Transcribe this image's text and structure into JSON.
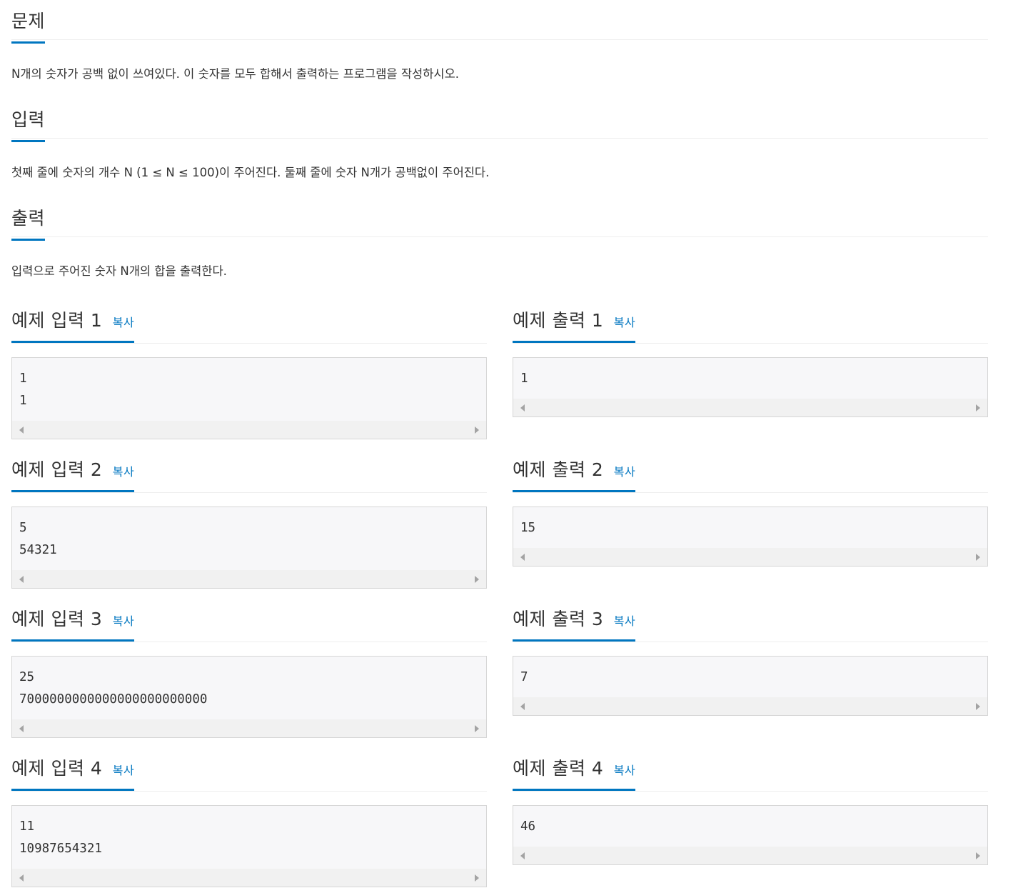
{
  "sections": [
    {
      "title": "문제",
      "text": "N개의 숫자가 공백 없이 쓰여있다. 이 숫자를 모두 합해서 출력하는 프로그램을 작성하시오."
    },
    {
      "title": "입력",
      "text": "첫째 줄에 숫자의 개수 N (1 ≤ N ≤ 100)이 주어진다. 둘째 줄에 숫자 N개가 공백없이 주어진다."
    },
    {
      "title": "출력",
      "text": "입력으로 주어진 숫자 N개의 합을 출력한다."
    }
  ],
  "copy_label": "복사",
  "samples": [
    {
      "input_title": "예제 입력 1",
      "input": "1\n1",
      "output_title": "예제 출력 1",
      "output": "1"
    },
    {
      "input_title": "예제 입력 2",
      "input": "5\n54321",
      "output_title": "예제 출력 2",
      "output": "15"
    },
    {
      "input_title": "예제 입력 3",
      "input": "25\n7000000000000000000000000",
      "output_title": "예제 출력 3",
      "output": "7"
    },
    {
      "input_title": "예제 입력 4",
      "input": "11\n10987654321",
      "output_title": "예제 출력 4",
      "output": "46"
    }
  ],
  "colors": {
    "accent": "#0076c0",
    "text": "#333333",
    "pre_bg": "#f7f7f9"
  }
}
